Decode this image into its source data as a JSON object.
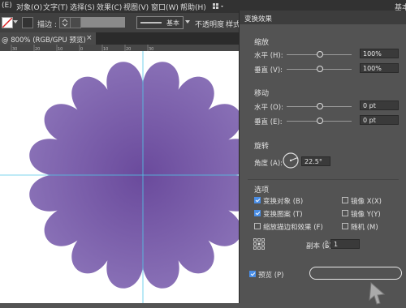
{
  "menubar": {
    "items": [
      "(E)",
      "对象(O)",
      "文字(T)",
      "选择(S)",
      "效果(C)",
      "视图(V)",
      "窗口(W)",
      "帮助(H)"
    ],
    "right_label": "基本"
  },
  "controlbar": {
    "stroke_label": "描边 :",
    "stroke_profile": "基本",
    "opacity_label": "不透明度",
    "style_label": "样式 :"
  },
  "document": {
    "tab_title": "@ 800% (RGB/GPU 预览)",
    "ruler_ticks": [
      "30",
      "20",
      "10",
      "0",
      "10",
      "20",
      "30"
    ]
  },
  "dialog": {
    "title": "变换效果",
    "scale": {
      "heading": "缩放",
      "horizontal_label": "水平 (H):",
      "horizontal_value": "100%",
      "vertical_label": "垂直 (V):",
      "vertical_value": "100%"
    },
    "move": {
      "heading": "移动",
      "horizontal_label": "水平 (O):",
      "horizontal_value": "0 pt",
      "vertical_label": "垂直 (E):",
      "vertical_value": "0 pt"
    },
    "rotate": {
      "heading": "旋转",
      "angle_label": "角度 (A):",
      "angle_value": "22.5°"
    },
    "options": {
      "heading": "选项",
      "transform_objects": {
        "label": "变换对象 (B)",
        "checked": true
      },
      "transform_patterns": {
        "label": "变换图案 (T)",
        "checked": true
      },
      "scale_strokes": {
        "label": "缩放描边和效果 (F)",
        "checked": false
      },
      "reflect_x": {
        "label": "镜像 X(X)",
        "checked": false
      },
      "reflect_y": {
        "label": "镜像 Y(Y)",
        "checked": false
      },
      "random": {
        "label": "随机 (M)",
        "checked": false
      }
    },
    "copies_label": "副本 (S)",
    "copies_value": "1",
    "preview": {
      "label": "预览 (P)",
      "checked": true
    }
  },
  "colors": {
    "flower_center": "#6a4a9c",
    "flower_edge": "#8b73b8",
    "guide": "#52c8e8",
    "checkbox_accent": "#4a8ee6"
  }
}
